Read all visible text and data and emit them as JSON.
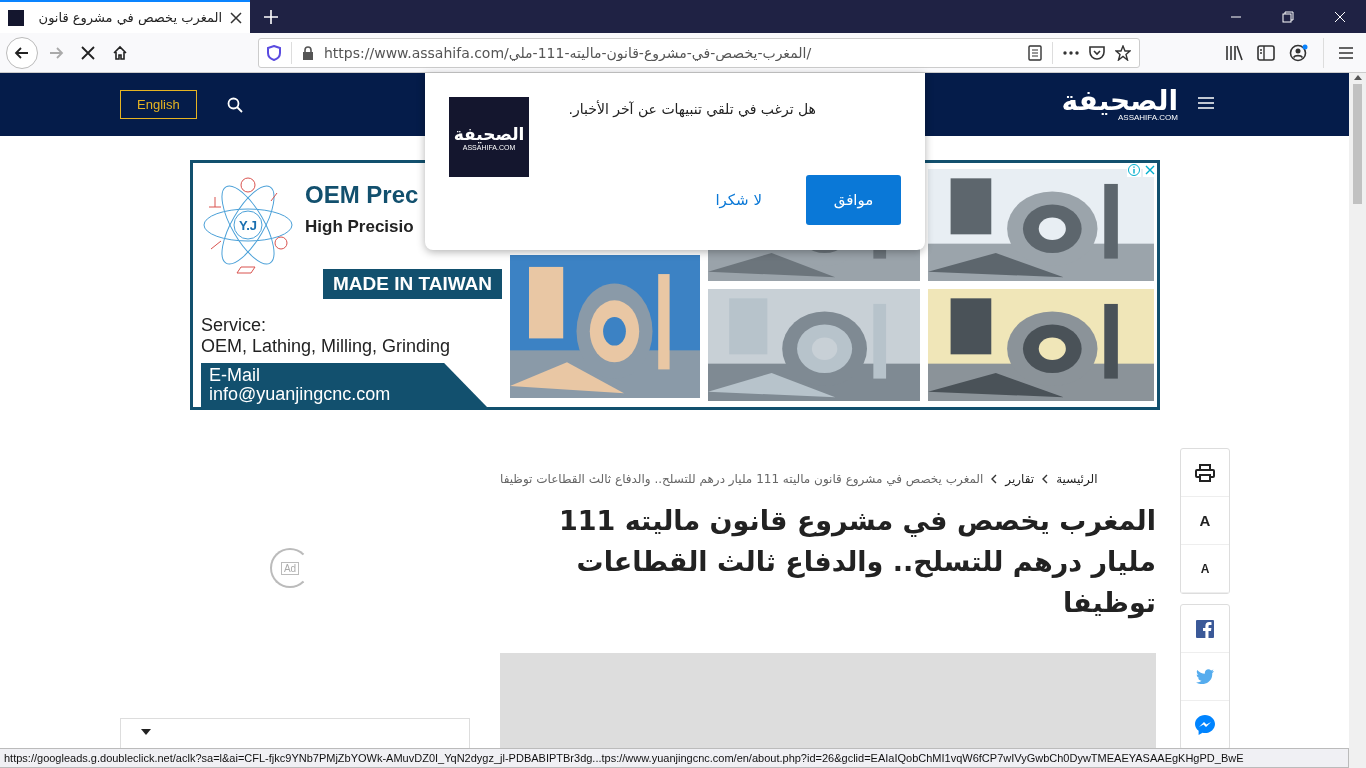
{
  "browser": {
    "tabs": [
      {
        "title": "المغرب يخصص في مشروع قانون",
        "selected": true
      }
    ],
    "url": "https://www.assahifa.com/المغرب-يخصص-في-مشروع-قانون-ماليته-111-ملي/"
  },
  "site_header": {
    "language_button": "English",
    "logo": "الصحيفة",
    "logo_sub": "ASSAHIFA.COM"
  },
  "notification": {
    "logo": "الصحيفة",
    "logo_sub": "ASSAHIFA.COM",
    "message": "هل ترغب في تلقي تنبيهات عن آخر الأخبار.",
    "buttons": [
      {
        "label": "موافق",
        "kind": "primary"
      },
      {
        "label": "لا شكرا",
        "kind": "link"
      }
    ]
  },
  "ad": {
    "logo": "Y.J",
    "headline": "OEM Prec",
    "subhead": "High Precisio",
    "banner": "MADE IN TAIWAN",
    "service_label": "Service:",
    "services": "OEM, Lathing, Milling, Grinding",
    "email_label": "E-Mail",
    "email": "info@yuanjingcnc.com"
  },
  "breadcrumb": [
    {
      "label": "الرئيسية",
      "kind": "link"
    },
    {
      "label": "تقارير",
      "kind": "link"
    },
    {
      "label": "المغرب يخصص في مشروع قانون ماليته 111 مليار درهم للتسلح.. والدفاع ثالث القطاعات توظيفا",
      "kind": "current"
    }
  ],
  "article": {
    "title": "المغرب يخصص في مشروع قانون ماليته 111 مليار درهم للتسلح.. والدفاع ثالث القطاعات توظيفا",
    "ad_marker": "Ad"
  },
  "tools": [
    {
      "kind": "print"
    },
    {
      "kind": "font",
      "label": "A"
    },
    {
      "kind": "font-small",
      "label": "A"
    }
  ],
  "share": [
    {
      "kind": "facebook"
    },
    {
      "kind": "twitter"
    },
    {
      "kind": "messenger"
    }
  ],
  "status_bar": "https://googleads.g.doubleclick.net/aclk?sa=l&ai=CFL-fjkc9YNb7PMjZbYOWk-AMuvDZ0I_YqN2dygz_jl-PDBABIPTBr3dg...tps://www.yuanjingcnc.com/en/about.php?id=26&gclid=EAIaIQobChMI1vqW6fCP7wIVyGwbCh0DywTMEAEYASAAEgKHgPD_BwE"
}
